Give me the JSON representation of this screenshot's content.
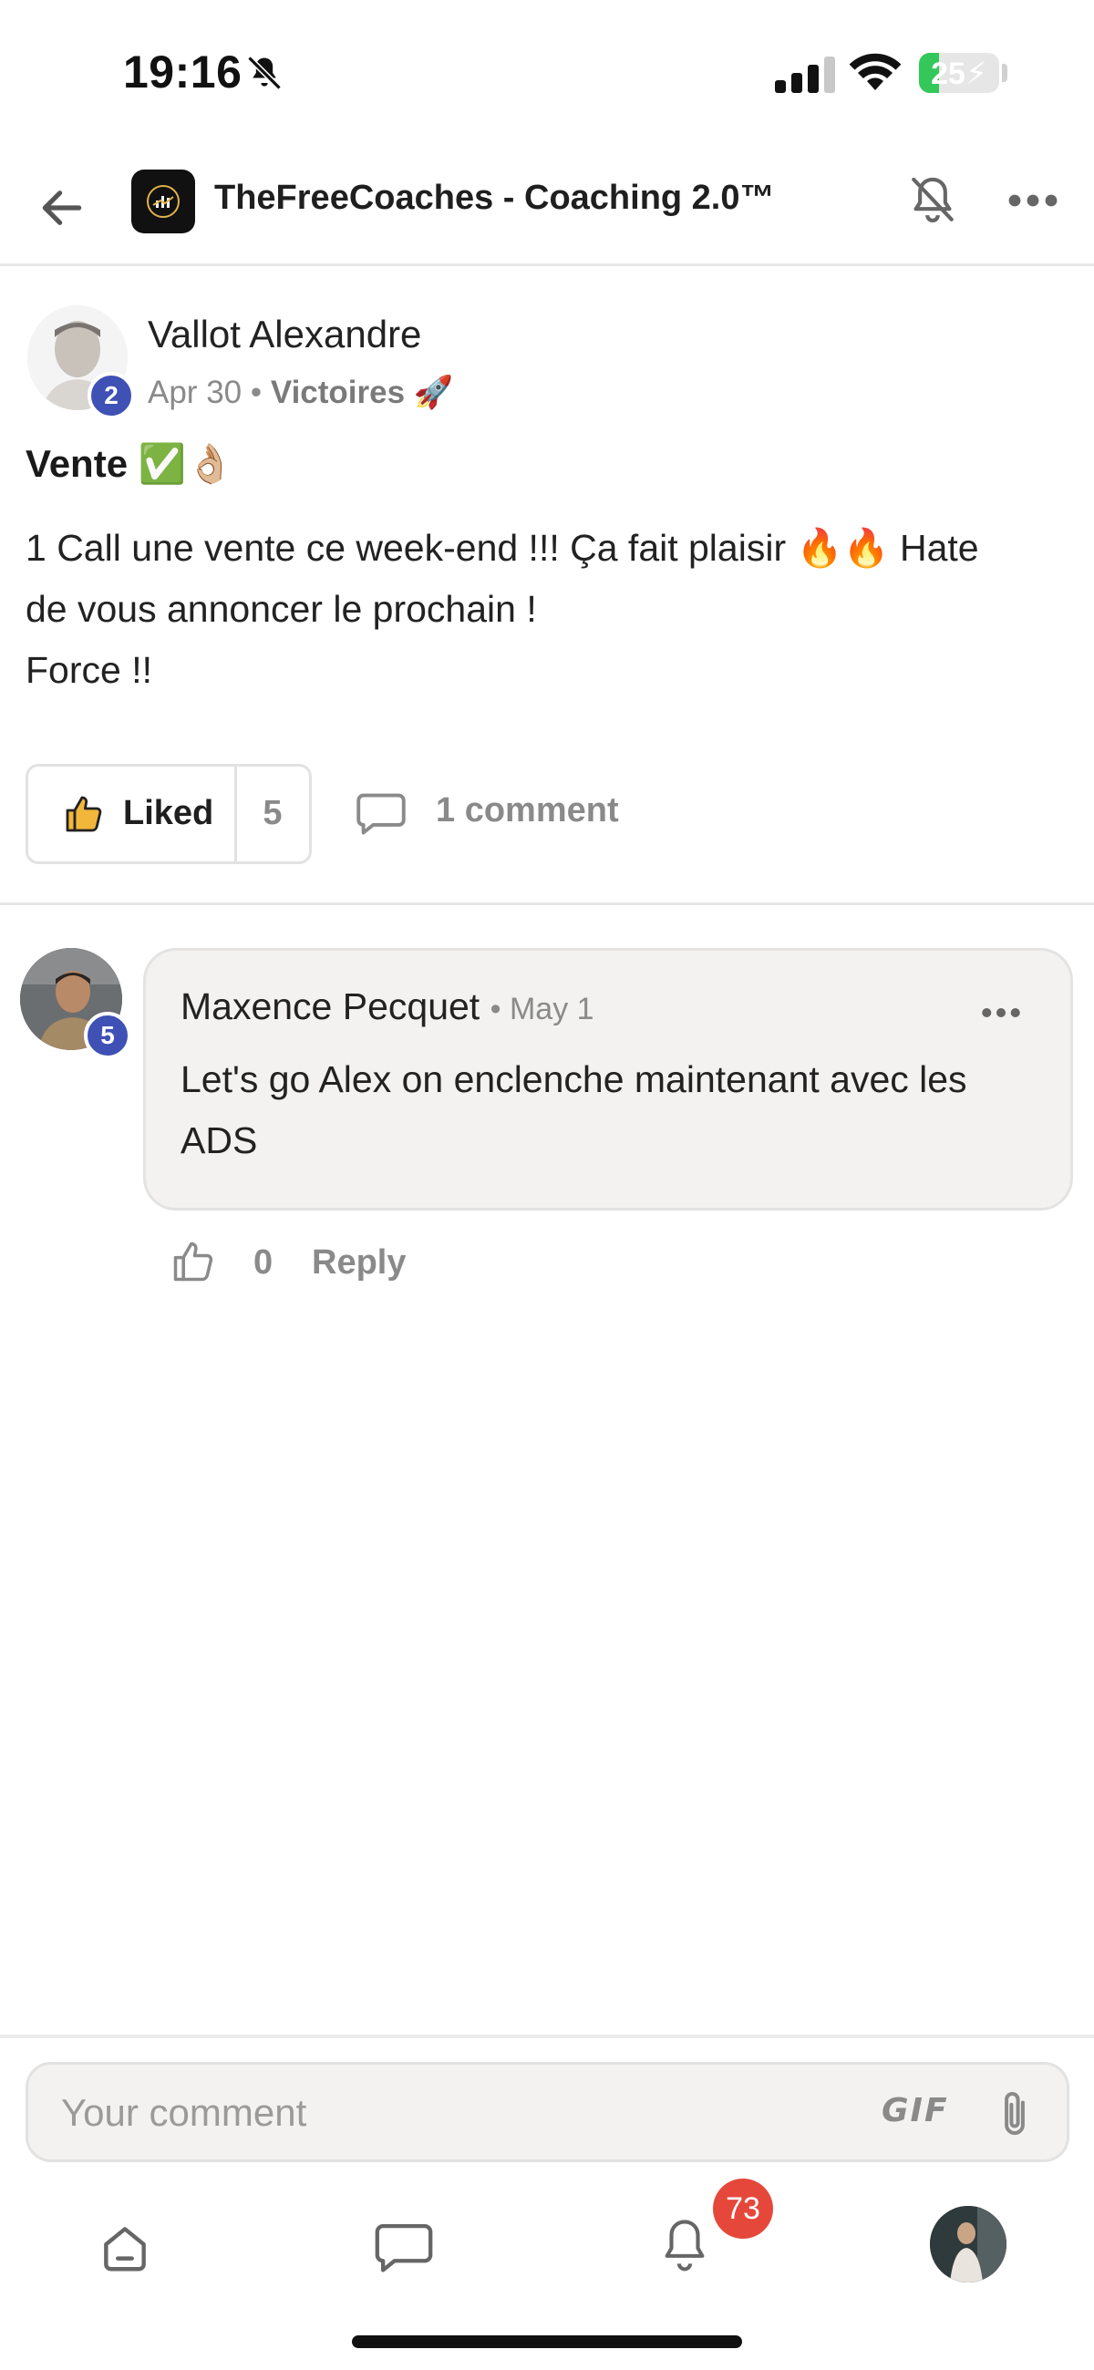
{
  "status_bar": {
    "time": "19:16",
    "battery_level": 25,
    "battery_text": "25",
    "icons": [
      "bell-slash-icon",
      "cellular-signal-icon",
      "wifi-icon",
      "battery-charging-icon"
    ]
  },
  "header": {
    "title": "TheFreeCoaches - Coaching 2.0™",
    "icons": [
      "back-arrow-icon",
      "group-logo",
      "bell-off-icon",
      "more-horizontal-icon"
    ]
  },
  "post": {
    "author": "Vallot Alexandre",
    "author_level": "2",
    "date": "Apr 30",
    "separator": "•",
    "category": "Victoires 🚀",
    "title": "Vente ✅👌🏼",
    "body_lines": [
      "1 Call une vente ce week-end !!! Ça fait plaisir 🔥🔥 Hate",
      "de vous annoncer le prochain !",
      "Force !!"
    ],
    "like_label": "Liked",
    "like_count": "5",
    "comment_label": "1 comment"
  },
  "comments": [
    {
      "author": "Maxence Pecquet",
      "author_level": "5",
      "date": "• May 1",
      "text_lines": [
        "Let's go Alex on enclenche maintenant avec les",
        "ADS"
      ],
      "like_count": "0",
      "reply_label": "Reply"
    }
  ],
  "composer": {
    "placeholder": "Your comment",
    "gif_label": "GIF"
  },
  "bottom_nav": {
    "notifications_badge": "73",
    "items": [
      "home-icon",
      "chat-icon",
      "notifications-icon",
      "profile-avatar"
    ]
  },
  "colors": {
    "accent_badge": "#3f51b5",
    "notification_badge": "#e5483a",
    "like_icon": "#f2b73a",
    "battery": "#34c759"
  }
}
